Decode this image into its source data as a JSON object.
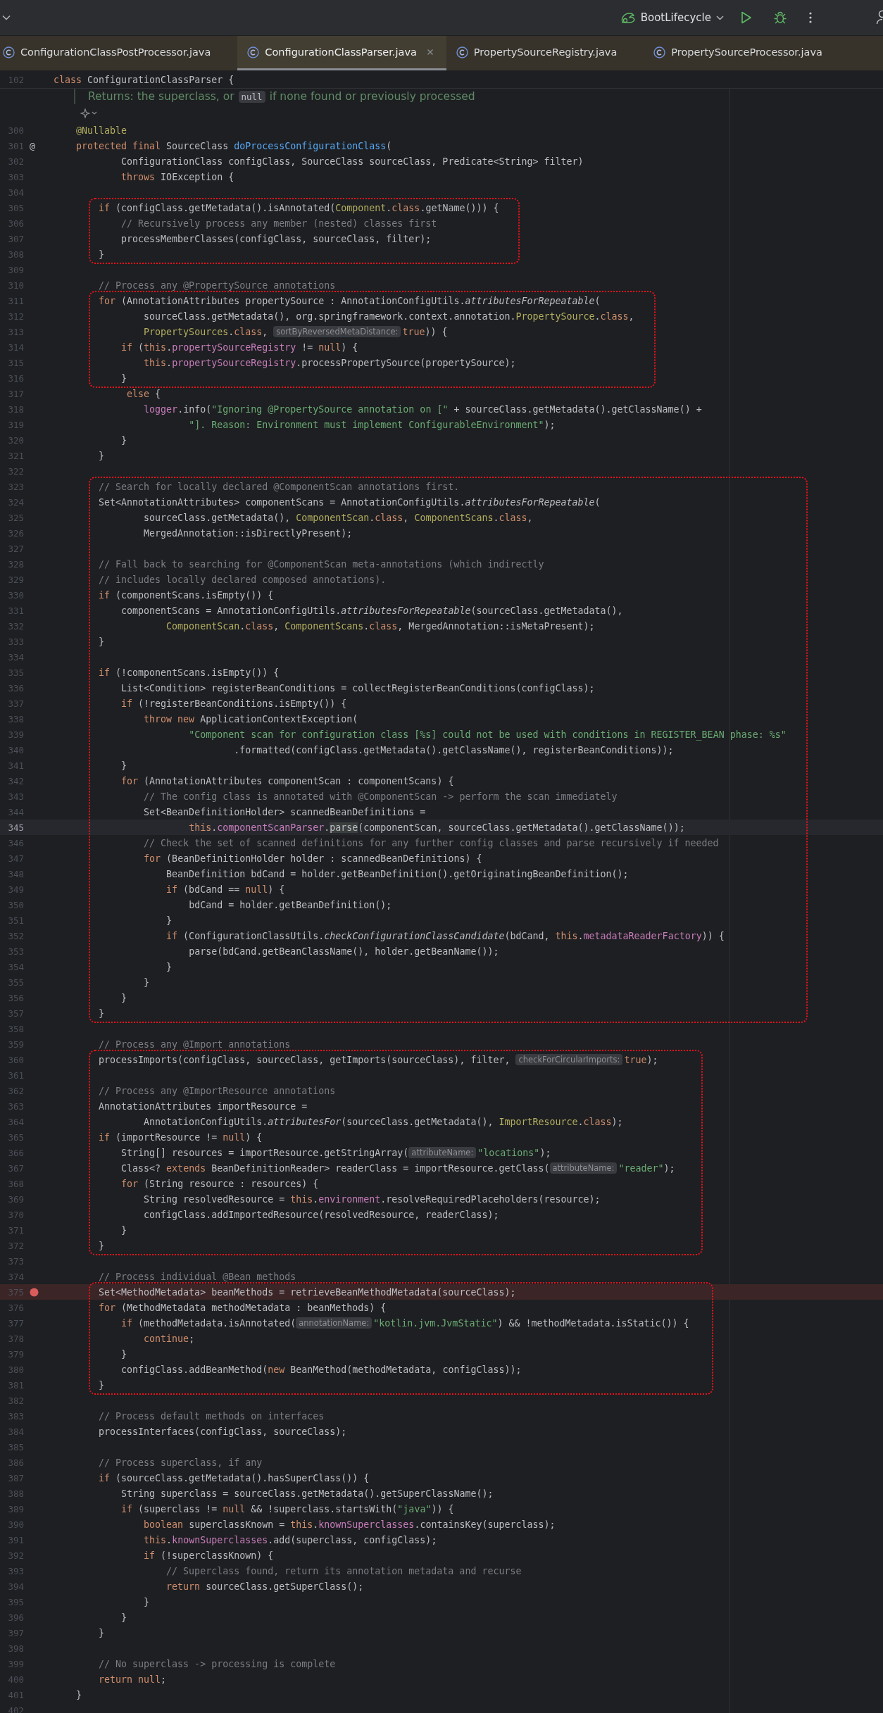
{
  "toolbar": {
    "run_configuration": "BootLifecycle"
  },
  "tabs": [
    {
      "label": "ConfigurationClassPostProcessor.java",
      "selected": false
    },
    {
      "label": "ConfigurationClassParser.java",
      "selected": true
    },
    {
      "label": "PropertySourceRegistry.java",
      "selected": false
    },
    {
      "label": "PropertySourceProcessor.java",
      "selected": false
    }
  ],
  "sticky_line": {
    "number": "102",
    "spans": [
      {
        "text": "class",
        "kind": "kw"
      },
      {
        "text": " ConfigurationClassParser {",
        "kind": "plain"
      }
    ]
  },
  "doc_comment": {
    "before": "Returns: the superclass, or",
    "code": "null",
    "after": "if none found or previously processed"
  },
  "sections": [
    {
      "marked": false,
      "lines": [
        {
          "number": "300",
          "spans": [
            {
              "text": "    @Nullable",
              "kind": "annotation"
            }
          ]
        },
        {
          "number": "301",
          "gutter_mark": "@",
          "spans": [
            {
              "text": "    protected final",
              "kind": "kw"
            },
            {
              "text": " SourceClass ",
              "kind": "plain"
            },
            {
              "text": "doProcessConfigurationClass",
              "kind": "decl"
            },
            {
              "text": "(",
              "kind": "plain"
            }
          ]
        },
        {
          "number": "302",
          "spans": [
            {
              "text": "            ConfigurationClass configClass, SourceClass sourceClass, Predicate<String> filter)",
              "kind": "plain"
            }
          ]
        },
        {
          "number": "303",
          "spans": [
            {
              "text": "            throws",
              "kind": "kw"
            },
            {
              "text": " IOException {",
              "kind": "plain"
            }
          ]
        },
        {
          "number": "304"
        }
      ]
    },
    {
      "marked": true,
      "lines": [
        {
          "number": "305",
          "spans": [
            {
              "text": "        if",
              "kind": "kw"
            },
            {
              "text": " (configClass.getMetadata().isAnnotated(",
              "kind": "plain"
            },
            {
              "text": "Component",
              "kind": "type"
            },
            {
              "text": ".class",
              "kind": "kw"
            },
            {
              "text": ".getName())) {",
              "kind": "plain"
            }
          ]
        },
        {
          "number": "306",
          "spans": [
            {
              "text": "            // Recursively process any member (nested) classes first",
              "kind": "comment"
            }
          ]
        },
        {
          "number": "307",
          "spans": [
            {
              "text": "            processMemberClasses(configClass, sourceClass, filter);",
              "kind": "plain"
            }
          ]
        },
        {
          "number": "308",
          "spans": [
            {
              "text": "        }",
              "kind": "plain"
            }
          ]
        }
      ]
    },
    {
      "marked": false,
      "lines": [
        {
          "number": "309"
        },
        {
          "number": "310",
          "spans": [
            {
              "text": "        // Process any @PropertySource annotations",
              "kind": "comment"
            }
          ]
        }
      ]
    },
    {
      "marked": true,
      "lines": [
        {
          "number": "311",
          "spans": [
            {
              "text": "        for",
              "kind": "kw"
            },
            {
              "text": " (AnnotationAttributes propertySource : AnnotationConfigUtils.",
              "kind": "plain"
            },
            {
              "text": "attributesForRepeatable",
              "kind": "static"
            },
            {
              "text": "(",
              "kind": "plain"
            }
          ]
        },
        {
          "number": "312",
          "spans": [
            {
              "text": "                sourceClass.getMetadata(), org.springframework.context.annotation.",
              "kind": "plain"
            },
            {
              "text": "PropertySource",
              "kind": "type"
            },
            {
              "text": ".class",
              "kind": "kw"
            },
            {
              "text": ",",
              "kind": "plain"
            }
          ]
        },
        {
          "number": "313",
          "spans": [
            {
              "text": "                PropertySources",
              "kind": "type"
            },
            {
              "text": ".class",
              "kind": "kw"
            },
            {
              "text": ", ",
              "kind": "plain"
            },
            {
              "text": "sortByReversedMetaDistance:",
              "kind": "hint"
            },
            {
              "text": "true",
              "kind": "kw"
            },
            {
              "text": ")) {",
              "kind": "plain"
            }
          ]
        },
        {
          "number": "314",
          "spans": [
            {
              "text": "            if",
              "kind": "kw"
            },
            {
              "text": " (",
              "kind": "plain"
            },
            {
              "text": "this",
              "kind": "kw"
            },
            {
              "text": ".propertySourceRegistry",
              "kind": "field"
            },
            {
              "text": " != ",
              "kind": "plain"
            },
            {
              "text": "null",
              "kind": "kw"
            },
            {
              "text": ") {",
              "kind": "plain"
            }
          ]
        },
        {
          "number": "315",
          "spans": [
            {
              "text": "                this",
              "kind": "kw"
            },
            {
              "text": ".propertySourceRegistry",
              "kind": "field"
            },
            {
              "text": ".processPropertySource(propertySource);",
              "kind": "plain"
            }
          ]
        },
        {
          "number": "316",
          "spans": [
            {
              "text": "            }",
              "kind": "plain"
            }
          ]
        }
      ]
    },
    {
      "marked": false,
      "lines": [
        {
          "number": "317",
          "spans": [
            {
              "text": "             else",
              "kind": "kw"
            },
            {
              "text": " {",
              "kind": "plain"
            }
          ]
        },
        {
          "number": "318",
          "spans": [
            {
              "text": "                logger",
              "kind": "field"
            },
            {
              "text": ".info(",
              "kind": "plain"
            },
            {
              "text": "\"Ignoring @PropertySource annotation on [\"",
              "kind": "string"
            },
            {
              "text": " + sourceClass.getMetadata().getClassName() +",
              "kind": "plain"
            }
          ]
        },
        {
          "number": "319",
          "spans": [
            {
              "text": "                        \"]. Reason: Environment must implement ConfigurableEnvironment\"",
              "kind": "string"
            },
            {
              "text": ");",
              "kind": "plain"
            }
          ]
        },
        {
          "number": "320",
          "spans": [
            {
              "text": "            }",
              "kind": "plain"
            }
          ]
        },
        {
          "number": "321",
          "spans": [
            {
              "text": "        }",
              "kind": "plain"
            }
          ]
        },
        {
          "number": "322"
        }
      ]
    },
    {
      "marked": true,
      "lines": [
        {
          "number": "323",
          "spans": [
            {
              "text": "        // Search for locally declared @ComponentScan annotations first.",
              "kind": "comment"
            }
          ]
        },
        {
          "number": "324",
          "spans": [
            {
              "text": "        Set<AnnotationAttributes> componentScans = AnnotationConfigUtils.",
              "kind": "plain"
            },
            {
              "text": "attributesForRepeatable",
              "kind": "static"
            },
            {
              "text": "(",
              "kind": "plain"
            }
          ]
        },
        {
          "number": "325",
          "spans": [
            {
              "text": "                sourceClass.getMetadata(), ",
              "kind": "plain"
            },
            {
              "text": "ComponentScan",
              "kind": "type"
            },
            {
              "text": ".class",
              "kind": "kw"
            },
            {
              "text": ", ",
              "kind": "plain"
            },
            {
              "text": "ComponentScans",
              "kind": "type"
            },
            {
              "text": ".class",
              "kind": "kw"
            },
            {
              "text": ",",
              "kind": "plain"
            }
          ]
        },
        {
          "number": "326",
          "spans": [
            {
              "text": "                MergedAnnotation::isDirectlyPresent);",
              "kind": "plain"
            }
          ]
        },
        {
          "number": "327"
        },
        {
          "number": "328",
          "spans": [
            {
              "text": "        // Fall back to searching for @ComponentScan meta-annotations (which indirectly",
              "kind": "comment"
            }
          ]
        },
        {
          "number": "329",
          "spans": [
            {
              "text": "        // includes locally declared composed annotations).",
              "kind": "comment"
            }
          ]
        },
        {
          "number": "330",
          "spans": [
            {
              "text": "        if",
              "kind": "kw"
            },
            {
              "text": " (componentScans.isEmpty()) {",
              "kind": "plain"
            }
          ]
        },
        {
          "number": "331",
          "spans": [
            {
              "text": "            componentScans = AnnotationConfigUtils.",
              "kind": "plain"
            },
            {
              "text": "attributesForRepeatable",
              "kind": "static"
            },
            {
              "text": "(sourceClass.getMetadata(),",
              "kind": "plain"
            }
          ]
        },
        {
          "number": "332",
          "spans": [
            {
              "text": "                    ComponentScan",
              "kind": "type"
            },
            {
              "text": ".class",
              "kind": "kw"
            },
            {
              "text": ", ",
              "kind": "plain"
            },
            {
              "text": "ComponentScans",
              "kind": "type"
            },
            {
              "text": ".class",
              "kind": "kw"
            },
            {
              "text": ", MergedAnnotation::isMetaPresent);",
              "kind": "plain"
            }
          ]
        },
        {
          "number": "333",
          "spans": [
            {
              "text": "        }",
              "kind": "plain"
            }
          ]
        },
        {
          "number": "334"
        },
        {
          "number": "335",
          "spans": [
            {
              "text": "        if",
              "kind": "kw"
            },
            {
              "text": " (!componentScans.isEmpty()) {",
              "kind": "plain"
            }
          ]
        },
        {
          "number": "336",
          "spans": [
            {
              "text": "            List<Condition> registerBeanConditions = collectRegisterBeanConditions(configClass);",
              "kind": "plain"
            }
          ]
        },
        {
          "number": "337",
          "spans": [
            {
              "text": "            if",
              "kind": "kw"
            },
            {
              "text": " (!registerBeanConditions.isEmpty()) {",
              "kind": "plain"
            }
          ]
        },
        {
          "number": "338",
          "spans": [
            {
              "text": "                throw new",
              "kind": "kw"
            },
            {
              "text": " ApplicationContextException(",
              "kind": "plain"
            }
          ]
        },
        {
          "number": "339",
          "spans": [
            {
              "text": "                        \"Component scan for configuration class [%s] could not be used with conditions in REGISTER_BEAN phase: %s\"",
              "kind": "string"
            }
          ]
        },
        {
          "number": "340",
          "spans": [
            {
              "text": "                                .formatted(configClass.getMetadata().getClassName(), registerBeanConditions));",
              "kind": "plain"
            }
          ]
        },
        {
          "number": "341",
          "spans": [
            {
              "text": "            }",
              "kind": "plain"
            }
          ]
        },
        {
          "number": "342",
          "spans": [
            {
              "text": "            for",
              "kind": "kw"
            },
            {
              "text": " (AnnotationAttributes componentScan : componentScans) {",
              "kind": "plain"
            }
          ]
        },
        {
          "number": "343",
          "spans": [
            {
              "text": "                // The config class is annotated with @ComponentScan -> perform the scan immediately",
              "kind": "comment"
            }
          ]
        },
        {
          "number": "344",
          "spans": [
            {
              "text": "                Set<BeanDefinitionHolder> scannedBeanDefinitions =",
              "kind": "plain"
            }
          ]
        },
        {
          "number": "345",
          "current": true,
          "spans": [
            {
              "text": "                        this",
              "kind": "kw"
            },
            {
              "text": ".componentScanParser",
              "kind": "field"
            },
            {
              "text": ".parse",
              "kind": "match"
            },
            {
              "text": "(componentScan, sourceClass.getMetadata().getClassName());",
              "kind": "plain"
            }
          ]
        },
        {
          "number": "346",
          "spans": [
            {
              "text": "                // Check the set of scanned definitions for any further config classes and parse recursively if needed",
              "kind": "comment"
            }
          ]
        },
        {
          "number": "347",
          "spans": [
            {
              "text": "                for",
              "kind": "kw"
            },
            {
              "text": " (BeanDefinitionHolder holder : scannedBeanDefinitions) {",
              "kind": "plain"
            }
          ]
        },
        {
          "number": "348",
          "spans": [
            {
              "text": "                    BeanDefinition bdCand = holder.getBeanDefinition().getOriginatingBeanDefinition();",
              "kind": "plain"
            }
          ]
        },
        {
          "number": "349",
          "spans": [
            {
              "text": "                    if",
              "kind": "kw"
            },
            {
              "text": " (bdCand == ",
              "kind": "plain"
            },
            {
              "text": "null",
              "kind": "kw"
            },
            {
              "text": ") {",
              "kind": "plain"
            }
          ]
        },
        {
          "number": "350",
          "spans": [
            {
              "text": "                        bdCand = holder.getBeanDefinition();",
              "kind": "plain"
            }
          ]
        },
        {
          "number": "351",
          "spans": [
            {
              "text": "                    }",
              "kind": "plain"
            }
          ]
        },
        {
          "number": "352",
          "spans": [
            {
              "text": "                    if",
              "kind": "kw"
            },
            {
              "text": " (ConfigurationClassUtils.",
              "kind": "plain"
            },
            {
              "text": "checkConfigurationClassCandidate",
              "kind": "static"
            },
            {
              "text": "(bdCand, ",
              "kind": "plain"
            },
            {
              "text": "this",
              "kind": "kw"
            },
            {
              "text": ".metadataReaderFactory",
              "kind": "field"
            },
            {
              "text": ")) {",
              "kind": "plain"
            }
          ]
        },
        {
          "number": "353",
          "spans": [
            {
              "text": "                        parse(bdCand.getBeanClassName(), holder.getBeanName());",
              "kind": "plain"
            }
          ]
        },
        {
          "number": "354",
          "spans": [
            {
              "text": "                    }",
              "kind": "plain"
            }
          ]
        },
        {
          "number": "355",
          "spans": [
            {
              "text": "                }",
              "kind": "plain"
            }
          ]
        },
        {
          "number": "356",
          "spans": [
            {
              "text": "            }",
              "kind": "plain"
            }
          ]
        },
        {
          "number": "357",
          "spans": [
            {
              "text": "        }",
              "kind": "plain"
            }
          ]
        }
      ]
    },
    {
      "marked": false,
      "lines": [
        {
          "number": "358"
        },
        {
          "number": "359",
          "spans": [
            {
              "text": "        // Process any @Import annotations",
              "kind": "comment"
            }
          ]
        }
      ]
    },
    {
      "marked": true,
      "lines": [
        {
          "number": "360",
          "spans": [
            {
              "text": "        processImports(configClass, sourceClass, getImports(sourceClass), filter, ",
              "kind": "plain"
            },
            {
              "text": "checkForCircularImports:",
              "kind": "hint"
            },
            {
              "text": "true",
              "kind": "kw"
            },
            {
              "text": ");",
              "kind": "plain"
            }
          ]
        },
        {
          "number": "361"
        },
        {
          "number": "362",
          "spans": [
            {
              "text": "        // Process any @ImportResource annotations",
              "kind": "comment"
            }
          ]
        },
        {
          "number": "363",
          "spans": [
            {
              "text": "        AnnotationAttributes importResource =",
              "kind": "plain"
            }
          ]
        },
        {
          "number": "364",
          "spans": [
            {
              "text": "                AnnotationConfigUtils.",
              "kind": "plain"
            },
            {
              "text": "attributesFor",
              "kind": "static"
            },
            {
              "text": "(sourceClass.getMetadata(), ",
              "kind": "plain"
            },
            {
              "text": "ImportResource",
              "kind": "type"
            },
            {
              "text": ".class",
              "kind": "kw"
            },
            {
              "text": ");",
              "kind": "plain"
            }
          ]
        },
        {
          "number": "365",
          "spans": [
            {
              "text": "        if",
              "kind": "kw"
            },
            {
              "text": " (importResource != ",
              "kind": "plain"
            },
            {
              "text": "null",
              "kind": "kw"
            },
            {
              "text": ") {",
              "kind": "plain"
            }
          ]
        },
        {
          "number": "366",
          "spans": [
            {
              "text": "            String[] resources = importResource.getStringArray(",
              "kind": "plain"
            },
            {
              "text": "attributeName:",
              "kind": "hint"
            },
            {
              "text": "\"locations\"",
              "kind": "string"
            },
            {
              "text": ");",
              "kind": "plain"
            }
          ]
        },
        {
          "number": "367",
          "spans": [
            {
              "text": "            Class<? ",
              "kind": "plain"
            },
            {
              "text": "extends",
              "kind": "kw"
            },
            {
              "text": " BeanDefinitionReader> readerClass = importResource.getClass(",
              "kind": "plain"
            },
            {
              "text": "attributeName:",
              "kind": "hint"
            },
            {
              "text": "\"reader\"",
              "kind": "string"
            },
            {
              "text": ");",
              "kind": "plain"
            }
          ]
        },
        {
          "number": "368",
          "spans": [
            {
              "text": "            for",
              "kind": "kw"
            },
            {
              "text": " (String resource : resources) {",
              "kind": "plain"
            }
          ]
        },
        {
          "number": "369",
          "spans": [
            {
              "text": "                String resolvedResource = ",
              "kind": "plain"
            },
            {
              "text": "this",
              "kind": "kw"
            },
            {
              "text": ".environment",
              "kind": "field"
            },
            {
              "text": ".resolveRequiredPlaceholders(resource);",
              "kind": "plain"
            }
          ]
        },
        {
          "number": "370",
          "spans": [
            {
              "text": "                configClass.addImportedResource(resolvedResource, readerClass);",
              "kind": "plain"
            }
          ]
        },
        {
          "number": "371",
          "spans": [
            {
              "text": "            }",
              "kind": "plain"
            }
          ]
        },
        {
          "number": "372",
          "spans": [
            {
              "text": "        }",
              "kind": "plain"
            }
          ]
        }
      ]
    },
    {
      "marked": false,
      "lines": [
        {
          "number": "373"
        },
        {
          "number": "374",
          "spans": [
            {
              "text": "        // Process individual @Bean methods",
              "kind": "comment"
            }
          ]
        }
      ]
    },
    {
      "marked": true,
      "lines": [
        {
          "number": "375",
          "breakpoint": true,
          "spans": [
            {
              "text": "        Set<MethodMetadata> beanMethods = retrieveBeanMethodMetadata(sourceClass);",
              "kind": "plain"
            }
          ]
        },
        {
          "number": "376",
          "spans": [
            {
              "text": "        for",
              "kind": "kw"
            },
            {
              "text": " (MethodMetadata methodMetadata : beanMethods) {",
              "kind": "plain"
            }
          ]
        },
        {
          "number": "377",
          "spans": [
            {
              "text": "            if",
              "kind": "kw"
            },
            {
              "text": " (methodMetadata.isAnnotated(",
              "kind": "plain"
            },
            {
              "text": "annotationName:",
              "kind": "hint"
            },
            {
              "text": "\"kotlin.jvm.JvmStatic\"",
              "kind": "string"
            },
            {
              "text": ") && !methodMetadata.isStatic()) {",
              "kind": "plain"
            }
          ]
        },
        {
          "number": "378",
          "spans": [
            {
              "text": "                continue",
              "kind": "kw"
            },
            {
              "text": ";",
              "kind": "plain"
            }
          ]
        },
        {
          "number": "379",
          "spans": [
            {
              "text": "            }",
              "kind": "plain"
            }
          ]
        },
        {
          "number": "380",
          "spans": [
            {
              "text": "            configClass.addBeanMethod(",
              "kind": "plain"
            },
            {
              "text": "new",
              "kind": "kw"
            },
            {
              "text": " BeanMethod(methodMetadata, configClass));",
              "kind": "plain"
            }
          ]
        },
        {
          "number": "381",
          "spans": [
            {
              "text": "        }",
              "kind": "plain"
            }
          ]
        }
      ]
    },
    {
      "marked": false,
      "lines": [
        {
          "number": "382"
        },
        {
          "number": "383",
          "spans": [
            {
              "text": "        // Process default methods on interfaces",
              "kind": "comment"
            }
          ]
        },
        {
          "number": "384",
          "spans": [
            {
              "text": "        processInterfaces(configClass, sourceClass);",
              "kind": "plain"
            }
          ]
        },
        {
          "number": "385"
        },
        {
          "number": "386",
          "spans": [
            {
              "text": "        // Process superclass, if any",
              "kind": "comment"
            }
          ]
        },
        {
          "number": "387",
          "spans": [
            {
              "text": "        if",
              "kind": "kw"
            },
            {
              "text": " (sourceClass.getMetadata().hasSuperClass()) {",
              "kind": "plain"
            }
          ]
        },
        {
          "number": "388",
          "spans": [
            {
              "text": "            String superclass = sourceClass.getMetadata().getSuperClassName();",
              "kind": "plain"
            }
          ]
        },
        {
          "number": "389",
          "spans": [
            {
              "text": "            if",
              "kind": "kw"
            },
            {
              "text": " (superclass != ",
              "kind": "plain"
            },
            {
              "text": "null",
              "kind": "kw"
            },
            {
              "text": " && !superclass.startsWith(",
              "kind": "plain"
            },
            {
              "text": "\"java\"",
              "kind": "string"
            },
            {
              "text": ")) {",
              "kind": "plain"
            }
          ]
        },
        {
          "number": "390",
          "spans": [
            {
              "text": "                boolean",
              "kind": "kw"
            },
            {
              "text": " superclassKnown = ",
              "kind": "plain"
            },
            {
              "text": "this",
              "kind": "kw"
            },
            {
              "text": ".knownSuperclasses",
              "kind": "field"
            },
            {
              "text": ".containsKey(superclass);",
              "kind": "plain"
            }
          ]
        },
        {
          "number": "391",
          "spans": [
            {
              "text": "                this",
              "kind": "kw"
            },
            {
              "text": ".knownSuperclasses",
              "kind": "field"
            },
            {
              "text": ".add(superclass, configClass);",
              "kind": "plain"
            }
          ]
        },
        {
          "number": "392",
          "spans": [
            {
              "text": "                if",
              "kind": "kw"
            },
            {
              "text": " (!superclassKnown) {",
              "kind": "plain"
            }
          ]
        },
        {
          "number": "393",
          "spans": [
            {
              "text": "                    // Superclass found, return its annotation metadata and recurse",
              "kind": "comment"
            }
          ]
        },
        {
          "number": "394",
          "spans": [
            {
              "text": "                    return",
              "kind": "kw"
            },
            {
              "text": " sourceClass.getSuperClass();",
              "kind": "plain"
            }
          ]
        },
        {
          "number": "395",
          "spans": [
            {
              "text": "                }",
              "kind": "plain"
            }
          ]
        },
        {
          "number": "396",
          "spans": [
            {
              "text": "            }",
              "kind": "plain"
            }
          ]
        },
        {
          "number": "397",
          "spans": [
            {
              "text": "        }",
              "kind": "plain"
            }
          ]
        },
        {
          "number": "398"
        },
        {
          "number": "399",
          "spans": [
            {
              "text": "        // No superclass -> processing is complete",
              "kind": "comment"
            }
          ]
        },
        {
          "number": "400",
          "spans": [
            {
              "text": "        return null",
              "kind": "kw"
            },
            {
              "text": ";",
              "kind": "plain"
            }
          ]
        },
        {
          "number": "401",
          "spans": [
            {
              "text": "    }",
              "kind": "plain"
            }
          ]
        },
        {
          "number": "402"
        }
      ]
    }
  ]
}
